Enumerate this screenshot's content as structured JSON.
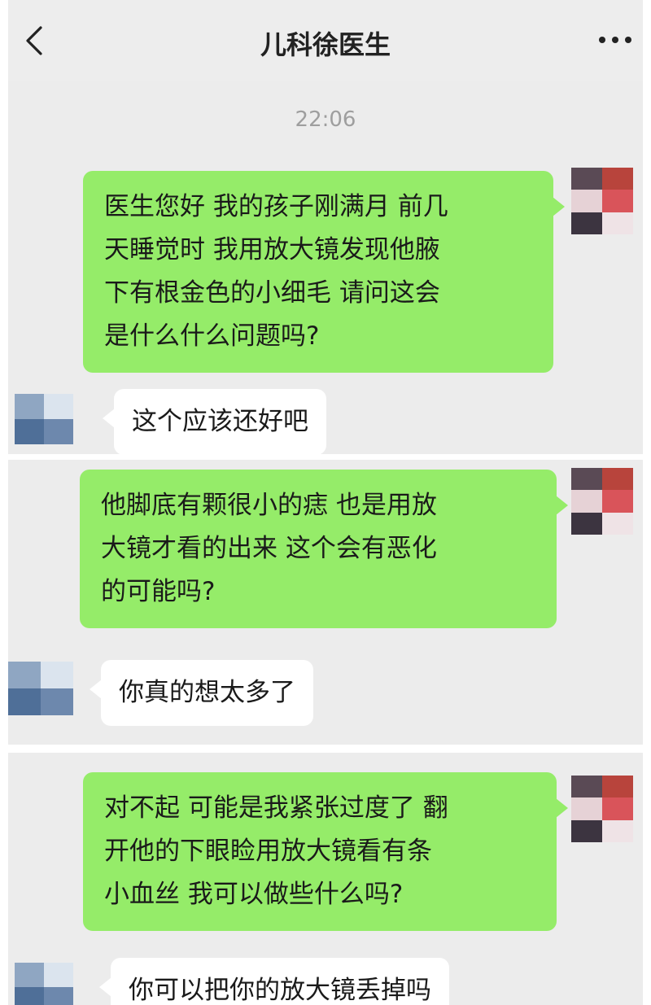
{
  "header": {
    "title": "儿科徐医生"
  },
  "time": "22:06",
  "messages": [
    {
      "from": "me",
      "lines": [
        "医生您好 我的孩子刚满月 前几",
        "天睡觉时 我用放大镜发现他腋",
        "下有根金色的小细毛 请问这会",
        "是什么什么问题吗?"
      ]
    },
    {
      "from": "doctor",
      "lines": [
        "这个应该还好吧"
      ]
    },
    {
      "from": "me",
      "lines": [
        "他脚底有颗很小的痣 也是用放",
        "大镜才看的出来 这个会有恶化",
        "的可能吗?"
      ]
    },
    {
      "from": "doctor",
      "lines": [
        "你真的想太多了"
      ]
    },
    {
      "from": "me",
      "lines": [
        "对不起 可能是我紧张过度了 翻",
        "开他的下眼睑用放大镜看有条",
        "小血丝 我可以做些什么吗?"
      ]
    },
    {
      "from": "doctor",
      "lines": [
        "你可以把你的放大镜丢掉吗"
      ]
    }
  ],
  "colors": {
    "outgoing_bubble": "#95ec69",
    "incoming_bubble": "#ffffff",
    "background": "#ececec"
  },
  "icons": {
    "back": "chevron-left-icon",
    "more": "more-dots-icon"
  }
}
